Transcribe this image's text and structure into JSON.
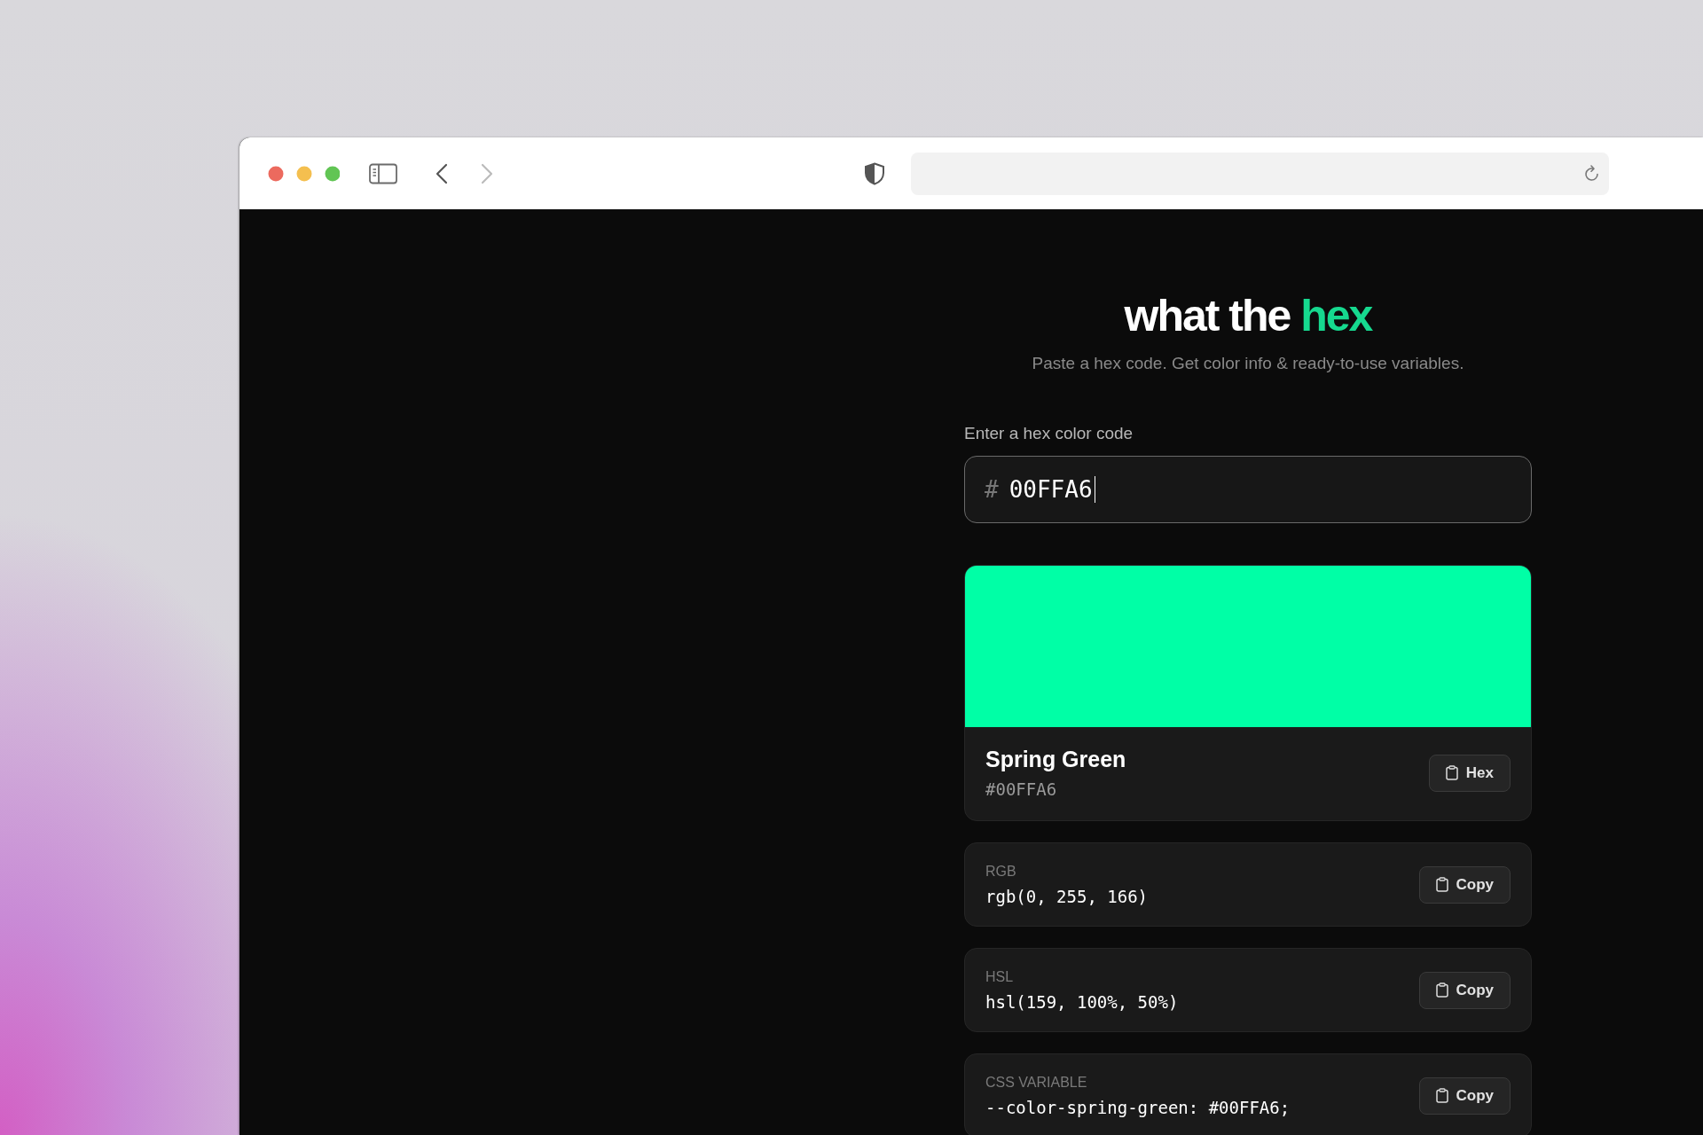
{
  "browser": {
    "back_enabled": true,
    "forward_enabled": false
  },
  "header": {
    "title": "what the",
    "title_accent": "hex",
    "subtitle": "Paste a hex code. Get color info & ready-to-use variables."
  },
  "input": {
    "label": "Enter a hex color code",
    "prefix": "#",
    "value": "00FFA6"
  },
  "swatch": {
    "color": "#00ffa6",
    "name": "Spring Green",
    "hex": "#00FFA6",
    "button": "Hex"
  },
  "formats": [
    {
      "label": "RGB",
      "value": "rgb(0, 255, 166)",
      "button": "Copy"
    },
    {
      "label": "HSL",
      "value": "hsl(159, 100%, 50%)",
      "button": "Copy"
    },
    {
      "label": "CSS VARIABLE",
      "value": "--color-spring-green: #00FFA6;",
      "button": "Copy"
    }
  ]
}
